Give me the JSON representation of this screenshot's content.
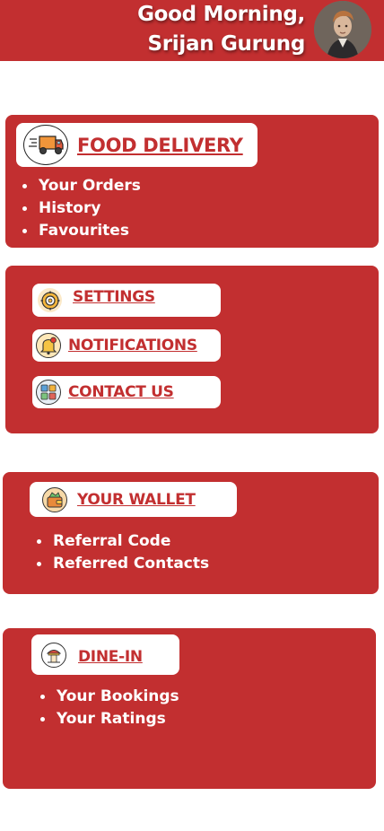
{
  "header": {
    "greeting": "Good Morning,",
    "user_name": "Srijan Gurung"
  },
  "food_delivery": {
    "title": "FOOD DELIVERY",
    "items": [
      "Your Orders",
      "History",
      "Favourites"
    ]
  },
  "menu": {
    "settings": "SETTINGS",
    "notifications": "NOTIFICATIONS",
    "contact_us": "CONTACT US"
  },
  "wallet": {
    "title": "YOUR WALLET",
    "items": [
      "Referral Code",
      "Referred Contacts"
    ]
  },
  "dine_in": {
    "title": "DINE-IN",
    "items": [
      "Your Bookings",
      "Your Ratings"
    ]
  },
  "colors": {
    "accent": "#c22f30",
    "text_on_accent": "#ffffff",
    "pill_background": "#ffffff"
  },
  "icons": {
    "food_delivery": "delivery-truck-icon",
    "settings": "gear-icon",
    "notifications": "bell-icon",
    "contact_us": "contact-book-icon",
    "wallet": "wallet-icon",
    "dine_in": "restaurant-icon"
  }
}
